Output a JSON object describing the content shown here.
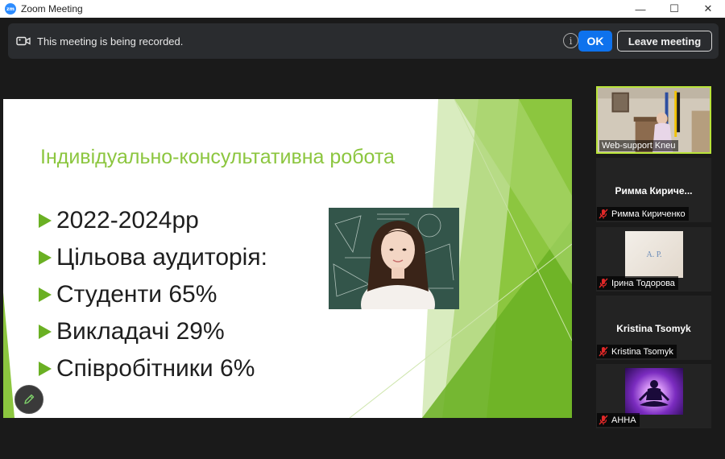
{
  "window": {
    "app_icon_text": "zm",
    "title": "Zoom Meeting",
    "minimize": "—",
    "maximize": "☐",
    "close": "✕"
  },
  "recording": {
    "message": "This meeting is being recorded.",
    "info_glyph": "i",
    "ok_label": "OK",
    "leave_label": "Leave meeting"
  },
  "slide": {
    "title": "Індивідуально-консультативна робота",
    "bullets": [
      "2022-2024рр",
      "Цільова аудиторія:",
      "Студенти 65%",
      "Викладачі 29%",
      "Співробітники 6%"
    ],
    "accent_color": "#8cc63f"
  },
  "participants": [
    {
      "name": "Web-support Kneu",
      "type": "video",
      "active_speaker": true
    },
    {
      "display_name": "Римма  Кириче...",
      "name": "Римма Кириченко",
      "muted": true,
      "type": "name"
    },
    {
      "avatar_text": "А. Р.",
      "name": "Ірина Тодорова",
      "muted": true,
      "type": "avatar"
    },
    {
      "display_name": "Kristina Tsomyk",
      "name": "Kristina Tsomyk",
      "muted": true,
      "type": "name"
    },
    {
      "name": "АННА",
      "muted": true,
      "type": "avatar"
    }
  ],
  "colors": {
    "primary_button": "#0e72ed",
    "active_speaker_border": "#b9e33a",
    "muted_mic": "#e02828"
  }
}
